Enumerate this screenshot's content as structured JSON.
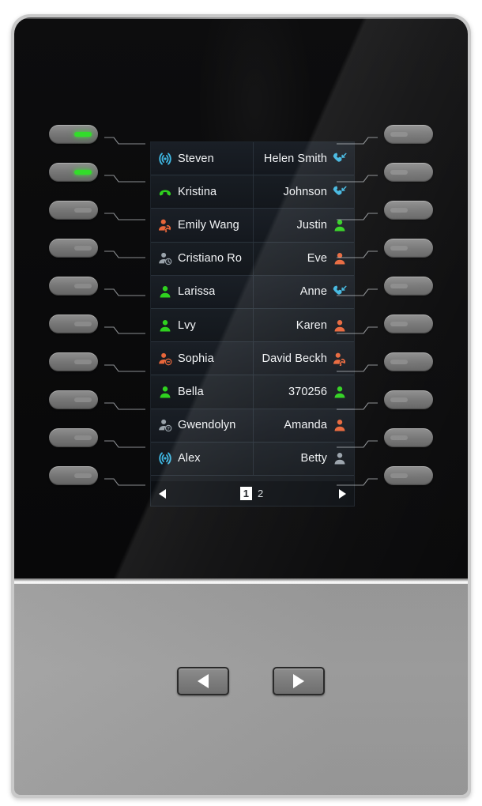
{
  "device": {
    "name": "phone-expansion-module",
    "colors": {
      "led_on": "#32dd2a",
      "led_off": "#8a8a8a",
      "screen_bg": "#14181d",
      "status_green": "#2fd11f",
      "status_orange": "#e8663a",
      "status_gray": "#9aa3ab",
      "status_blue": "#3fb6e0",
      "body_gray": "#9b9b9b"
    }
  },
  "screen": {
    "rows": [
      {
        "left": {
          "label": "Steven",
          "icon": "shared-line-icon",
          "icon_color": "#3fb6e0"
        },
        "right": {
          "label": "Helen Smith",
          "icon": "forwarded-call-icon",
          "icon_color": "#3fb6e0"
        }
      },
      {
        "left": {
          "label": "Kristina",
          "icon": "handset-ringing-icon",
          "icon_color": "#2fd11f"
        },
        "right": {
          "label": "Johnson",
          "icon": "forwarded-call-icon",
          "icon_color": "#3fb6e0"
        }
      },
      {
        "left": {
          "label": "Emily Wang",
          "icon": "user-talking-icon",
          "icon_color": "#e8663a"
        },
        "right": {
          "label": "Justin",
          "icon": "user-icon",
          "icon_color": "#2fd11f"
        }
      },
      {
        "left": {
          "label": "Cristiano Ro",
          "icon": "user-away-icon",
          "icon_color": "#9aa3ab"
        },
        "right": {
          "label": "Eve",
          "icon": "user-icon",
          "icon_color": "#e8663a"
        }
      },
      {
        "left": {
          "label": "Larissa",
          "icon": "user-icon",
          "icon_color": "#2fd11f"
        },
        "right": {
          "label": "Anne",
          "icon": "forwarded-call-icon",
          "icon_color": "#3fb6e0"
        }
      },
      {
        "left": {
          "label": "Lvy",
          "icon": "user-icon",
          "icon_color": "#2fd11f"
        },
        "right": {
          "label": "Karen",
          "icon": "user-icon",
          "icon_color": "#e8663a"
        }
      },
      {
        "left": {
          "label": "Sophia",
          "icon": "user-dnd-icon",
          "icon_color": "#e8663a"
        },
        "right": {
          "label": "David Beckh",
          "icon": "user-talking-icon",
          "icon_color": "#e8663a"
        }
      },
      {
        "left": {
          "label": "Bella",
          "icon": "user-icon",
          "icon_color": "#2fd11f"
        },
        "right": {
          "label": "370256",
          "icon": "user-icon",
          "icon_color": "#2fd11f"
        }
      },
      {
        "left": {
          "label": "Gwendolyn",
          "icon": "user-unknown-icon",
          "icon_color": "#9aa3ab"
        },
        "right": {
          "label": "Amanda",
          "icon": "user-icon",
          "icon_color": "#e8663a"
        }
      },
      {
        "left": {
          "label": "Alex",
          "icon": "shared-line-icon",
          "icon_color": "#3fb6e0"
        },
        "right": {
          "label": "Betty",
          "icon": "user-icon",
          "icon_color": "#9aa3ab"
        }
      }
    ],
    "pager": {
      "prev_icon": "triangle-left-icon",
      "next_icon": "triangle-right-icon",
      "pages": [
        "1",
        "2"
      ],
      "active_page": "1"
    }
  },
  "left_keys": [
    {
      "name": "line-key-1",
      "led": "on"
    },
    {
      "name": "line-key-2",
      "led": "on"
    },
    {
      "name": "line-key-3",
      "led": "off"
    },
    {
      "name": "line-key-4",
      "led": "off"
    },
    {
      "name": "line-key-5",
      "led": "off"
    },
    {
      "name": "line-key-6",
      "led": "off"
    },
    {
      "name": "line-key-7",
      "led": "off"
    },
    {
      "name": "line-key-8",
      "led": "off"
    },
    {
      "name": "line-key-9",
      "led": "off"
    },
    {
      "name": "line-key-10",
      "led": "off"
    }
  ],
  "right_keys": [
    {
      "name": "line-key-11",
      "led": "off"
    },
    {
      "name": "line-key-12",
      "led": "off"
    },
    {
      "name": "line-key-13",
      "led": "off"
    },
    {
      "name": "line-key-14",
      "led": "off"
    },
    {
      "name": "line-key-15",
      "led": "off"
    },
    {
      "name": "line-key-16",
      "led": "off"
    },
    {
      "name": "line-key-17",
      "led": "off"
    },
    {
      "name": "line-key-18",
      "led": "off"
    },
    {
      "name": "line-key-19",
      "led": "off"
    },
    {
      "name": "line-key-20",
      "led": "off"
    }
  ],
  "bottom_buttons": [
    {
      "name": "page-prev-button",
      "icon": "triangle-left-icon"
    },
    {
      "name": "page-next-button",
      "icon": "triangle-right-icon"
    }
  ]
}
